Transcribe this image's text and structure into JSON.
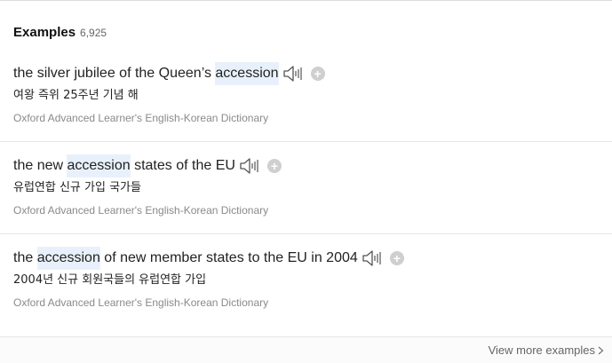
{
  "section": {
    "title": "Examples",
    "count": "6,925"
  },
  "examples": [
    {
      "before": "the silver jubilee of the Queen’s ",
      "highlight": "accession",
      "after": "",
      "translation": "여왕 즉위 25주년 기념 해",
      "source": "Oxford Advanced Learner's English-Korean Dictionary"
    },
    {
      "before": "the new ",
      "highlight": "accession",
      "after": " states of the EU",
      "translation": "유럽연합 신규 가입 국가들",
      "source": "Oxford Advanced Learner's English-Korean Dictionary"
    },
    {
      "before": "the ",
      "highlight": "accession",
      "after": " of new member states to the EU in 2004",
      "translation": "2004년 신규 회원국들의 유럽연합 가입",
      "source": "Oxford Advanced Learner's English-Korean Dictionary"
    }
  ],
  "icons": {
    "speaker": "speaker-icon",
    "add": "plus-circle-icon",
    "chevron": "chevron-right-icon"
  },
  "footer": {
    "view_more_label": "View more examples"
  },
  "colors": {
    "highlight_bg": "#e8f1fb",
    "source_text": "#8a8a8a",
    "divider": "#e6e6e6"
  }
}
